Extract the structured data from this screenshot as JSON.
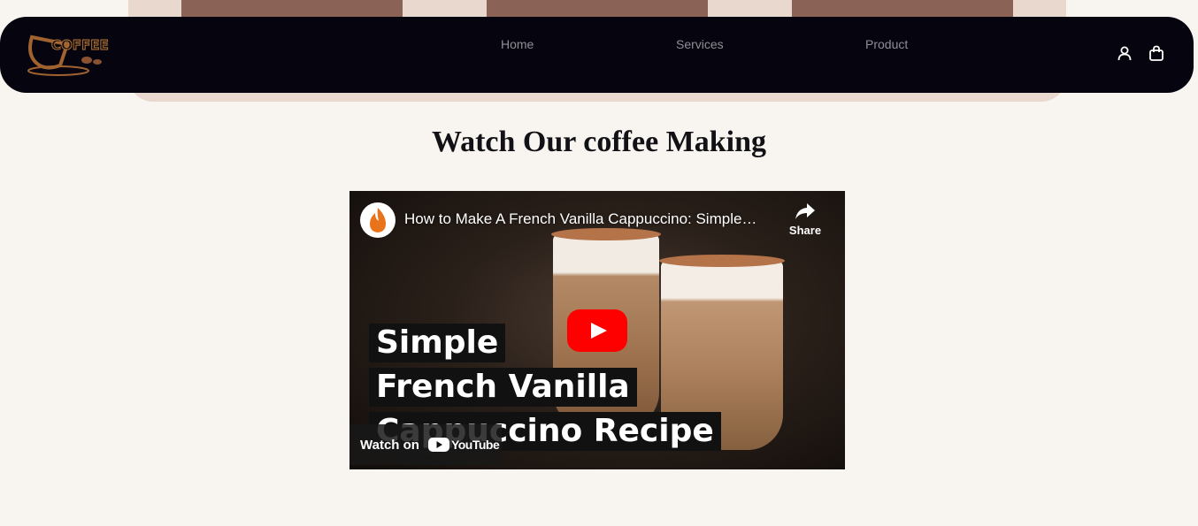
{
  "navbar": {
    "logo_text": "COFFEE",
    "links": [
      {
        "label": "Home"
      },
      {
        "label": "Services"
      },
      {
        "label": "Product"
      }
    ]
  },
  "section": {
    "title": "Watch Our coffee Making"
  },
  "video": {
    "title": "How to Make A French Vanilla Cappuccino: Simple…",
    "share_label": "Share",
    "overlay_lines": [
      "Simple",
      "French Vanilla",
      "Cappuccino Recipe"
    ],
    "watch_on_label": "Watch on",
    "youtube_label": "YouTube"
  },
  "colors": {
    "navbar_bg": "#05040f",
    "page_bg": "#f8f4ef",
    "band": "#e8d8cd",
    "band_block": "#8a6256",
    "play_red": "#ff0000"
  }
}
